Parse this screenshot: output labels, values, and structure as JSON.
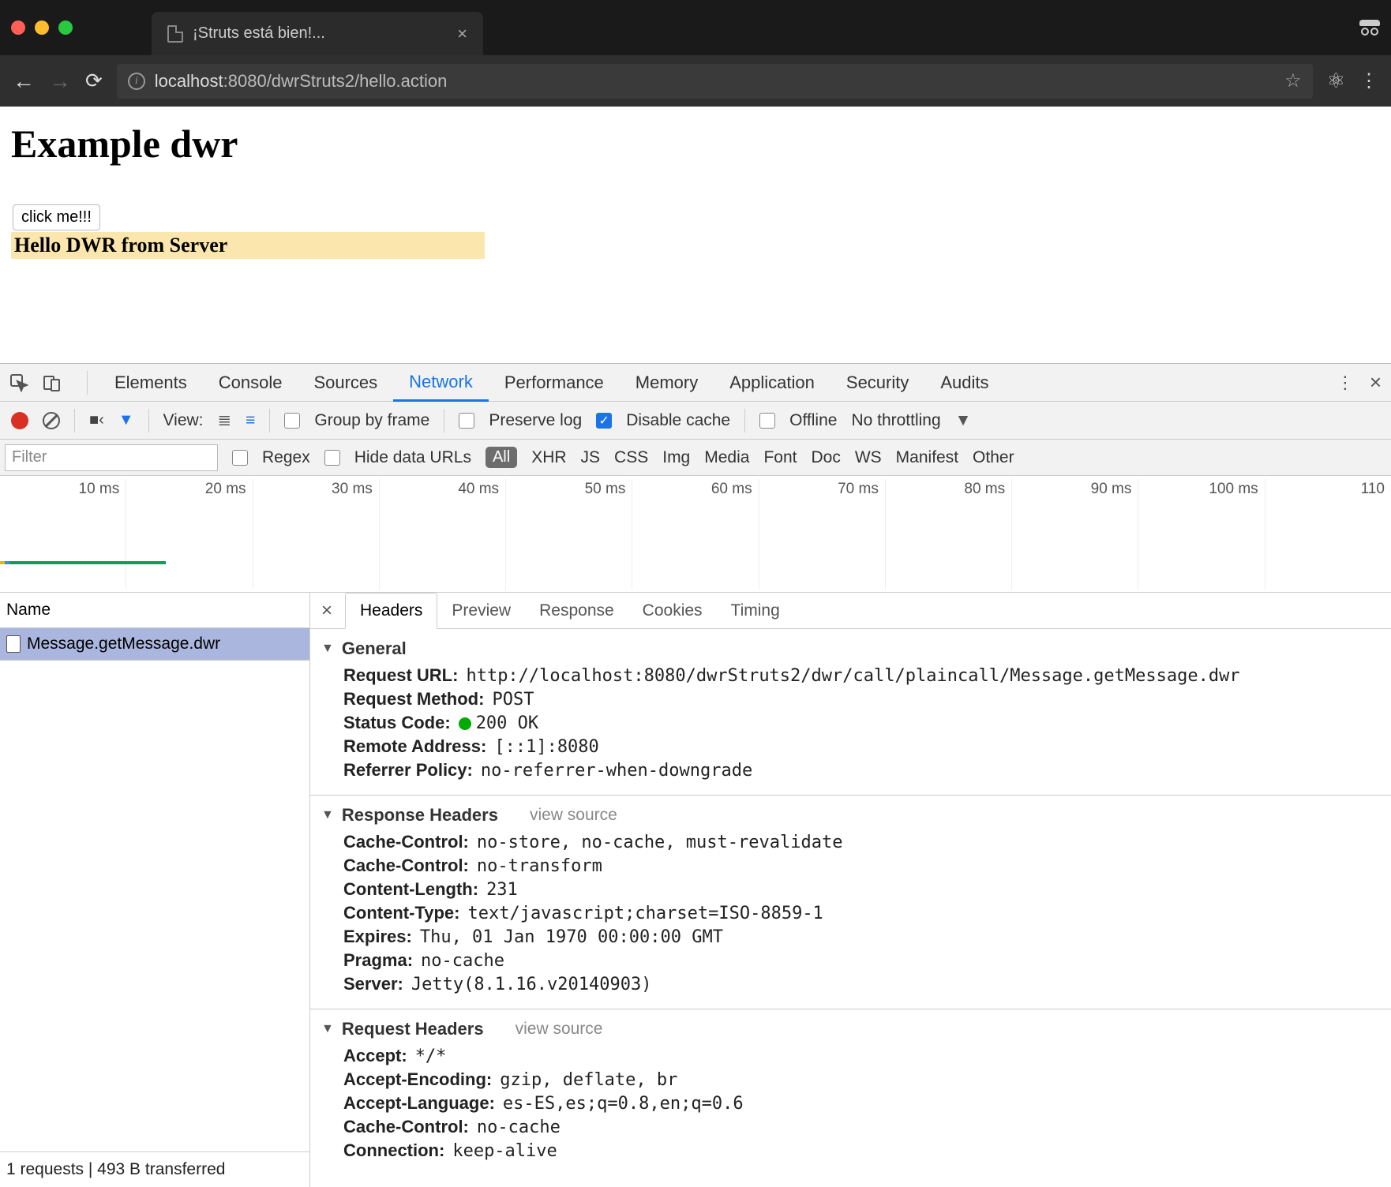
{
  "window": {
    "tab_title": "¡Struts está bien!..."
  },
  "url": {
    "host": "localhost",
    "port_path": ":8080/dwrStruts2/hello.action"
  },
  "page": {
    "heading": "Example dwr",
    "button_label": "click me!!!",
    "highlight_text": "Hello DWR from Server"
  },
  "devtools": {
    "tabs": [
      "Elements",
      "Console",
      "Sources",
      "Network",
      "Performance",
      "Memory",
      "Application",
      "Security",
      "Audits"
    ],
    "active_tab": "Network",
    "toolbar": {
      "view_label": "View:",
      "group_by_frame": "Group by frame",
      "preserve_log": "Preserve log",
      "disable_cache": "Disable cache",
      "offline": "Offline",
      "throttling": "No throttling"
    },
    "filterrow": {
      "filter_placeholder": "Filter",
      "regex": "Regex",
      "hide_data_urls": "Hide data URLs",
      "type_all": "All",
      "types": [
        "XHR",
        "JS",
        "CSS",
        "Img",
        "Media",
        "Font",
        "Doc",
        "WS",
        "Manifest",
        "Other"
      ]
    },
    "timeline_labels": [
      "10 ms",
      "20 ms",
      "30 ms",
      "40 ms",
      "50 ms",
      "60 ms",
      "70 ms",
      "80 ms",
      "90 ms",
      "100 ms",
      "110"
    ],
    "reqlist": {
      "header": "Name",
      "row": "Message.getMessage.dwr",
      "footer": "1 requests | 493 B transferred"
    },
    "detail_tabs": [
      "Headers",
      "Preview",
      "Response",
      "Cookies",
      "Timing"
    ],
    "active_detail_tab": "Headers",
    "general": {
      "title": "General",
      "request_url_k": "Request URL:",
      "request_url_v": "http://localhost:8080/dwrStruts2/dwr/call/plaincall/Message.getMessage.dwr",
      "request_method_k": "Request Method:",
      "request_method_v": "POST",
      "status_code_k": "Status Code:",
      "status_code_v": "200 OK",
      "remote_addr_k": "Remote Address:",
      "remote_addr_v": "[::1]:8080",
      "referrer_policy_k": "Referrer Policy:",
      "referrer_policy_v": "no-referrer-when-downgrade"
    },
    "response_headers": {
      "title": "Response Headers",
      "view_source": "view source",
      "items": [
        {
          "k": "Cache-Control:",
          "v": "no-store, no-cache, must-revalidate"
        },
        {
          "k": "Cache-Control:",
          "v": "no-transform"
        },
        {
          "k": "Content-Length:",
          "v": "231"
        },
        {
          "k": "Content-Type:",
          "v": "text/javascript;charset=ISO-8859-1"
        },
        {
          "k": "Expires:",
          "v": "Thu, 01 Jan 1970 00:00:00 GMT"
        },
        {
          "k": "Pragma:",
          "v": "no-cache"
        },
        {
          "k": "Server:",
          "v": "Jetty(8.1.16.v20140903)"
        }
      ]
    },
    "request_headers": {
      "title": "Request Headers",
      "view_source": "view source",
      "items": [
        {
          "k": "Accept:",
          "v": "*/*"
        },
        {
          "k": "Accept-Encoding:",
          "v": "gzip, deflate, br"
        },
        {
          "k": "Accept-Language:",
          "v": "es-ES,es;q=0.8,en;q=0.6"
        },
        {
          "k": "Cache-Control:",
          "v": "no-cache"
        },
        {
          "k": "Connection:",
          "v": "keep-alive"
        }
      ]
    }
  }
}
